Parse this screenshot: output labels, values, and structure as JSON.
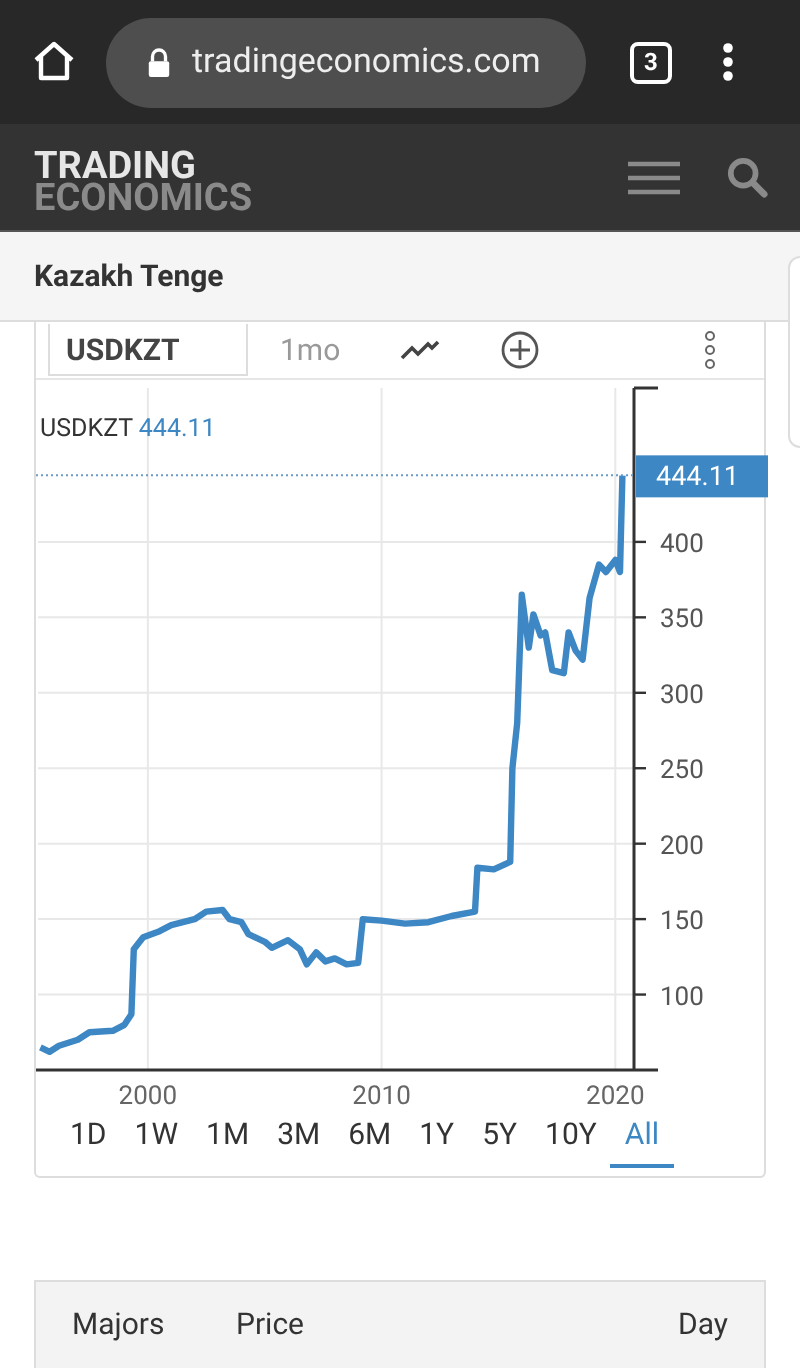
{
  "browser": {
    "url": "tradingeconomics.com",
    "tab_count": "3"
  },
  "site": {
    "logo_top": "TRADING",
    "logo_bottom": "ECONOMICS"
  },
  "page_title": "Kazakh Tenge",
  "toolbar": {
    "symbol": "USDKZT",
    "interval": "1mo"
  },
  "chart": {
    "legend_symbol": "USDKZT",
    "legend_value": "444.11",
    "chart_data": {
      "type": "line",
      "grid": true,
      "xlim": [
        1995.3,
        2020.8
      ],
      "ylim": [
        50,
        502
      ],
      "xticks": [
        2000,
        2010,
        2020
      ],
      "yticks": [
        100,
        150,
        200,
        250,
        300,
        350,
        400
      ],
      "x": [
        1995.4,
        1995.8,
        1996.2,
        1997,
        1997.5,
        1998.5,
        1999,
        1999.3,
        1999.4,
        1999.8,
        2000.5,
        2001,
        2002,
        2002.5,
        2003.2,
        2003.5,
        2004,
        2004.3,
        2005,
        2005.3,
        2006,
        2006.5,
        2006.8,
        2007.2,
        2007.6,
        2008,
        2008.5,
        2009,
        2009.2,
        2010,
        2011,
        2012,
        2013,
        2014,
        2014.1,
        2014.8,
        2015.5,
        2015.6,
        2015.8,
        2016,
        2016.3,
        2016.5,
        2016.8,
        2017,
        2017.3,
        2017.8,
        2018,
        2018.3,
        2018.6,
        2018.9,
        2019.3,
        2019.6,
        2020,
        2020.2,
        2020.3
      ],
      "series": [
        {
          "color": "#3d87c4",
          "values": [
            65,
            62,
            66,
            70,
            75,
            76,
            80,
            87,
            130,
            138,
            142,
            146,
            150,
            155,
            156,
            150,
            148,
            140,
            135,
            131,
            136,
            130,
            120,
            128,
            122,
            124,
            120,
            121,
            150,
            149,
            147,
            148,
            152,
            155,
            184,
            183,
            188,
            250,
            280,
            365,
            330,
            352,
            338,
            340,
            315,
            313,
            340,
            328,
            322,
            363,
            385,
            380,
            388,
            380,
            444
          ]
        }
      ],
      "ref_lines": [
        {
          "axis": "y",
          "value": 444.11,
          "label": "444.11"
        }
      ]
    }
  },
  "ranges": [
    {
      "label": "1D",
      "selected": false
    },
    {
      "label": "1W",
      "selected": false
    },
    {
      "label": "1M",
      "selected": false
    },
    {
      "label": "3M",
      "selected": false
    },
    {
      "label": "6M",
      "selected": false
    },
    {
      "label": "1Y",
      "selected": false
    },
    {
      "label": "5Y",
      "selected": false
    },
    {
      "label": "10Y",
      "selected": false
    },
    {
      "label": "All",
      "selected": true
    }
  ],
  "table": {
    "columns": [
      "Majors",
      "Price",
      "Day"
    ]
  }
}
